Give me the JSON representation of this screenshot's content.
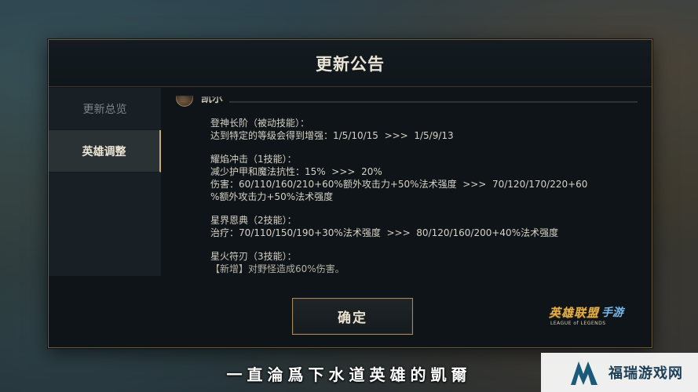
{
  "dialog": {
    "title": "更新公告",
    "sidebar": {
      "tabs": [
        {
          "label": "更新总览",
          "active": false
        },
        {
          "label": "英雄调整",
          "active": true
        }
      ]
    },
    "hero": {
      "name": "凯尔"
    },
    "skills": [
      {
        "name": "登神长阶（被动技能）：",
        "lines": [
          "达到特定的等级会得到增强：1/5/10/15  >>>  1/5/9/13"
        ]
      },
      {
        "name": "耀焰冲击（1技能）：",
        "lines": [
          "减少护甲和魔法抗性：15%  >>>  20%",
          "伤害：60/110/160/210+60%额外攻击力+50%法术强度  >>>  70/120/170/220+60",
          "%额外攻击力+50%法术强度"
        ]
      },
      {
        "name": "星界恩典（2技能）：",
        "lines": [
          "治疗：70/110/150/190+30%法术强度  >>>  80/120/160/200+40%法术强度"
        ]
      },
      {
        "name": "星火符刃（3技能）：",
        "lines": [
          "【新增】对野怪造成60%伤害。"
        ]
      }
    ],
    "confirm_label": "确定",
    "logo": {
      "main": "英雄联盟",
      "mobile": "手游",
      "sub": "LEAGUE of LEGENDS"
    }
  },
  "subtitle": "一直淪爲下水道英雄的凱爾",
  "watermark": {
    "text": "福瑞游戏网"
  },
  "colors": {
    "gold_border": "#a38a5c",
    "panel": "#0e1418",
    "accent_gold": "#c8aa6e"
  }
}
